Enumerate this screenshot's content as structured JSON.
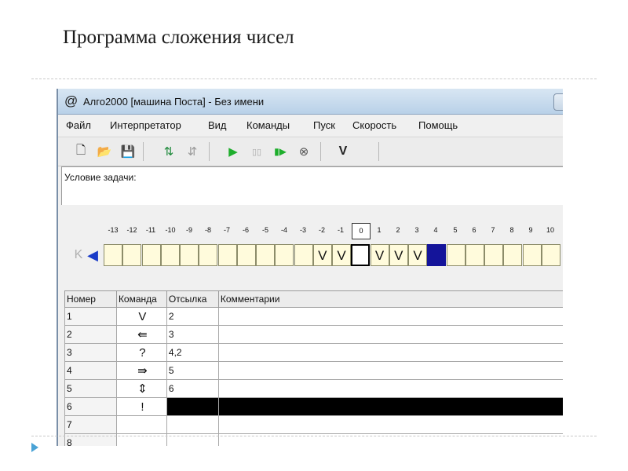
{
  "slide": {
    "title": "Программа сложения чисел"
  },
  "window": {
    "icon": "@",
    "title": "Алго2000 [машина Поста] - Без имени"
  },
  "menu": [
    "Файл",
    "Интерпретатор",
    "Вид",
    "Команды",
    "Пуск",
    "Скорость",
    "Помощь"
  ],
  "toolbar": {
    "buttons": [
      {
        "name": "new-file-icon",
        "glyph": "🗋"
      },
      {
        "name": "open-folder-icon",
        "glyph": "📂"
      },
      {
        "name": "save-disk-icon",
        "glyph": "💾"
      },
      {
        "name": "tape-to-program-icon",
        "glyph": "⇅"
      },
      {
        "name": "program-to-tape-icon",
        "glyph": "⇵"
      },
      {
        "name": "run-play-icon",
        "glyph": "▶"
      },
      {
        "name": "pause-icon",
        "glyph": "▯▯"
      },
      {
        "name": "step-icon",
        "glyph": "▮▶"
      },
      {
        "name": "stop-icon",
        "glyph": "⊗"
      },
      {
        "name": "mark-v-icon",
        "glyph": "V"
      }
    ]
  },
  "task_panel": {
    "label": "Условие задачи:"
  },
  "tape": {
    "numbers": [
      "-13",
      "-12",
      "-11",
      "-10",
      "-9",
      "-8",
      "-7",
      "-6",
      "-5",
      "-4",
      "-3",
      "-2",
      "-1",
      "0",
      "1",
      "2",
      "3",
      "4",
      "5",
      "6",
      "7",
      "8",
      "9",
      "10"
    ],
    "nav_left_disabled": "K",
    "nav_left": "◀",
    "cells": [
      "",
      "",
      "",
      "",
      "",
      "",
      "",
      "",
      "",
      "",
      "",
      "V",
      "V",
      "",
      "V",
      "V",
      "V",
      "",
      "",
      "",
      "",
      "",
      "",
      ""
    ],
    "current_index": 13,
    "carriage_index": 17
  },
  "table": {
    "headers": [
      "Номер",
      "Команда",
      "Отсылка",
      "Комментарии"
    ],
    "rows": [
      {
        "num": "1",
        "cmd": "V",
        "ref": "2",
        "comment": ""
      },
      {
        "num": "2",
        "cmd": "⇚",
        "ref": "3",
        "comment": ""
      },
      {
        "num": "3",
        "cmd": "?",
        "ref": "4,2",
        "comment": ""
      },
      {
        "num": "4",
        "cmd": "⇛",
        "ref": "5",
        "comment": ""
      },
      {
        "num": "5",
        "cmd": "⇕",
        "ref": "6",
        "comment": ""
      },
      {
        "num": "6",
        "cmd": "!",
        "ref": "",
        "comment": ""
      },
      {
        "num": "7",
        "cmd": "",
        "ref": "",
        "comment": ""
      },
      {
        "num": "8",
        "cmd": "",
        "ref": "",
        "comment": ""
      }
    ]
  },
  "colors": {
    "carriage": "#14149a",
    "tape_cell": "#fffbdc",
    "bullet": "#4aa3d6"
  }
}
